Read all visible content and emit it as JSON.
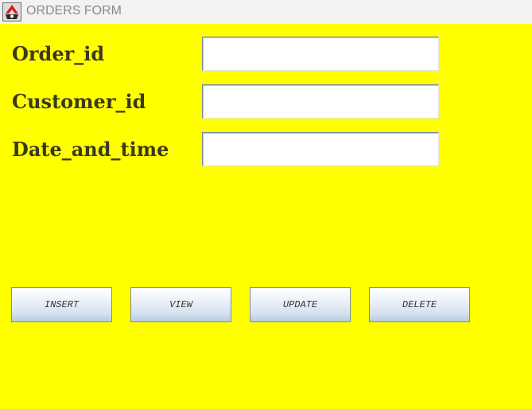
{
  "window": {
    "title": "ORDERS FORM",
    "icon": "java-app-icon"
  },
  "colors": {
    "background": "#ffff00",
    "label_text": "#3a3a1a",
    "titlebar_bg": "#f2f2f2",
    "title_text": "#8a8a8a"
  },
  "form": {
    "fields": [
      {
        "label": "Order_id",
        "value": ""
      },
      {
        "label": "Customer_id",
        "value": ""
      },
      {
        "label": "Date_and_time",
        "value": ""
      }
    ]
  },
  "buttons": {
    "insert_label": "INSERT",
    "view_label": "VIEW",
    "update_label": "UPDATE",
    "delete_label": "DELETE"
  }
}
